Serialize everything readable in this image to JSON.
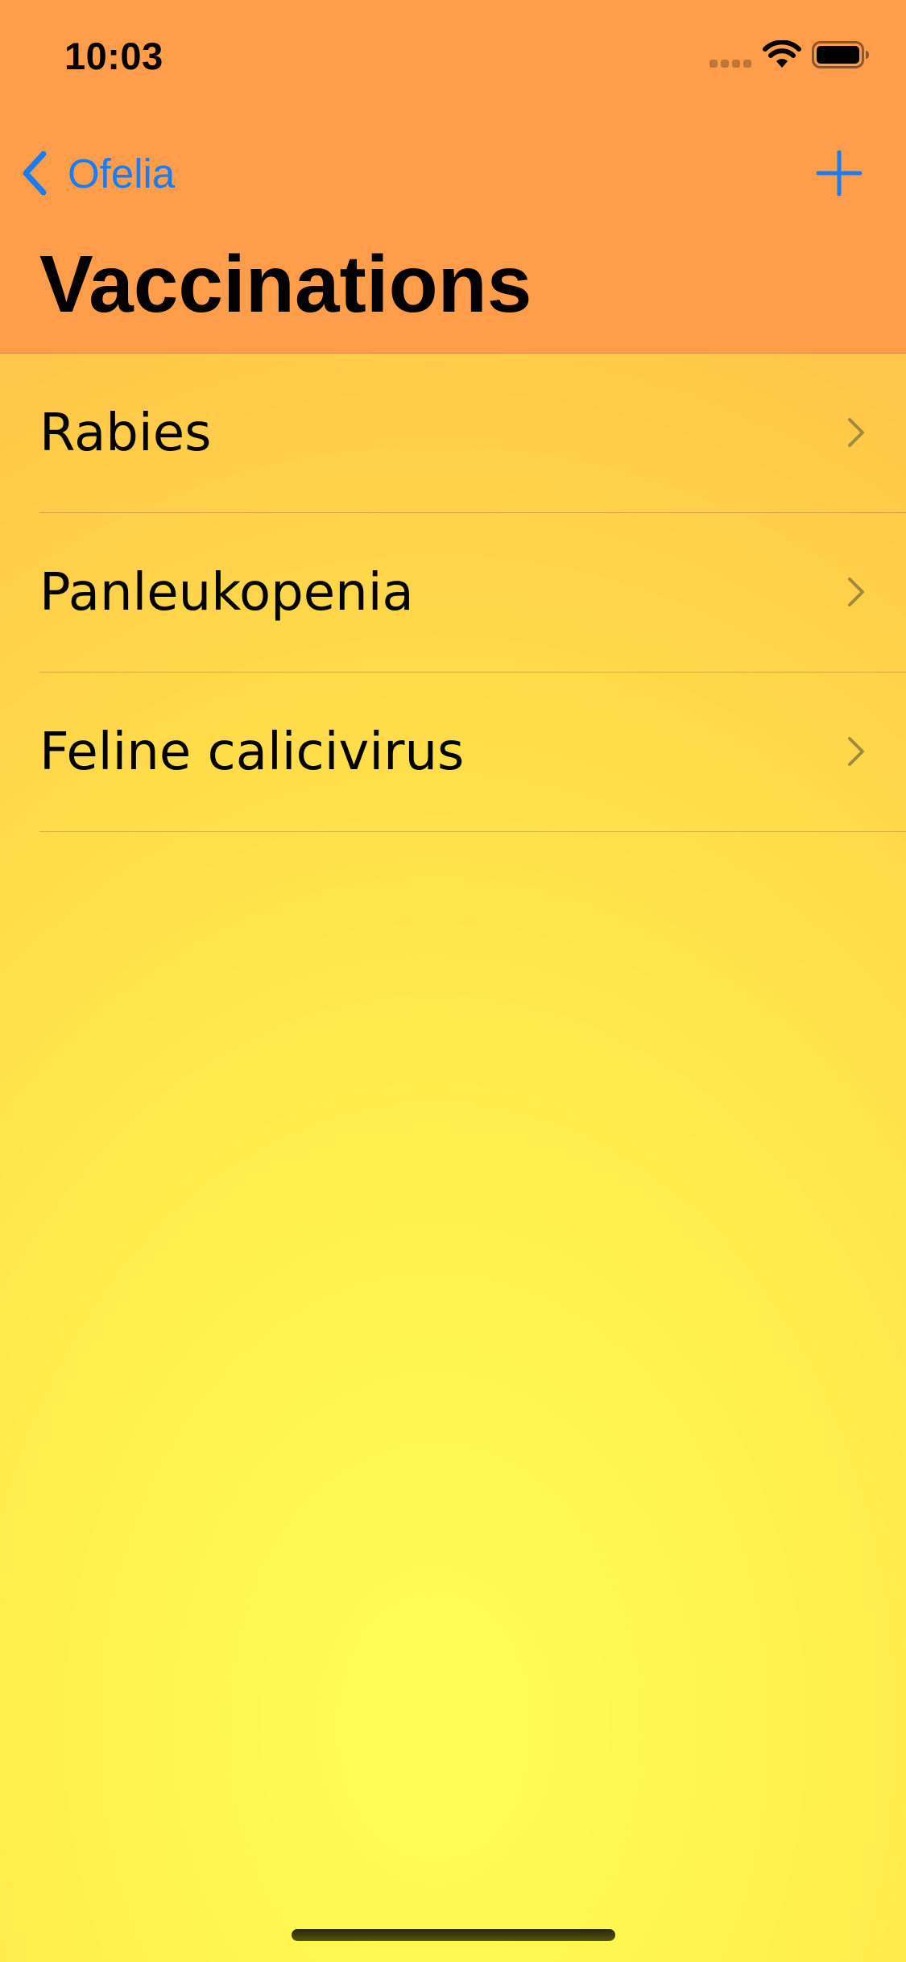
{
  "status_bar": {
    "time": "10:03",
    "icons": [
      "cellular-signal-icon",
      "wifi-icon",
      "battery-icon"
    ]
  },
  "nav": {
    "back_label": "Ofelia",
    "back_icon": "chevron-left-icon",
    "add_icon": "plus-icon",
    "title": "Vaccinations"
  },
  "list": {
    "items": [
      {
        "label": "Rabies",
        "icon": "chevron-right-icon"
      },
      {
        "label": "Panleukopenia",
        "icon": "chevron-right-icon"
      },
      {
        "label": "Feline calicivirus",
        "icon": "chevron-right-icon"
      }
    ]
  },
  "colors": {
    "header_bg": "#ff9d4b",
    "accent": "#1a7cf2",
    "background_center": "#ffff55",
    "background_edge": "#ffc648",
    "chevron": "#a08a40"
  }
}
